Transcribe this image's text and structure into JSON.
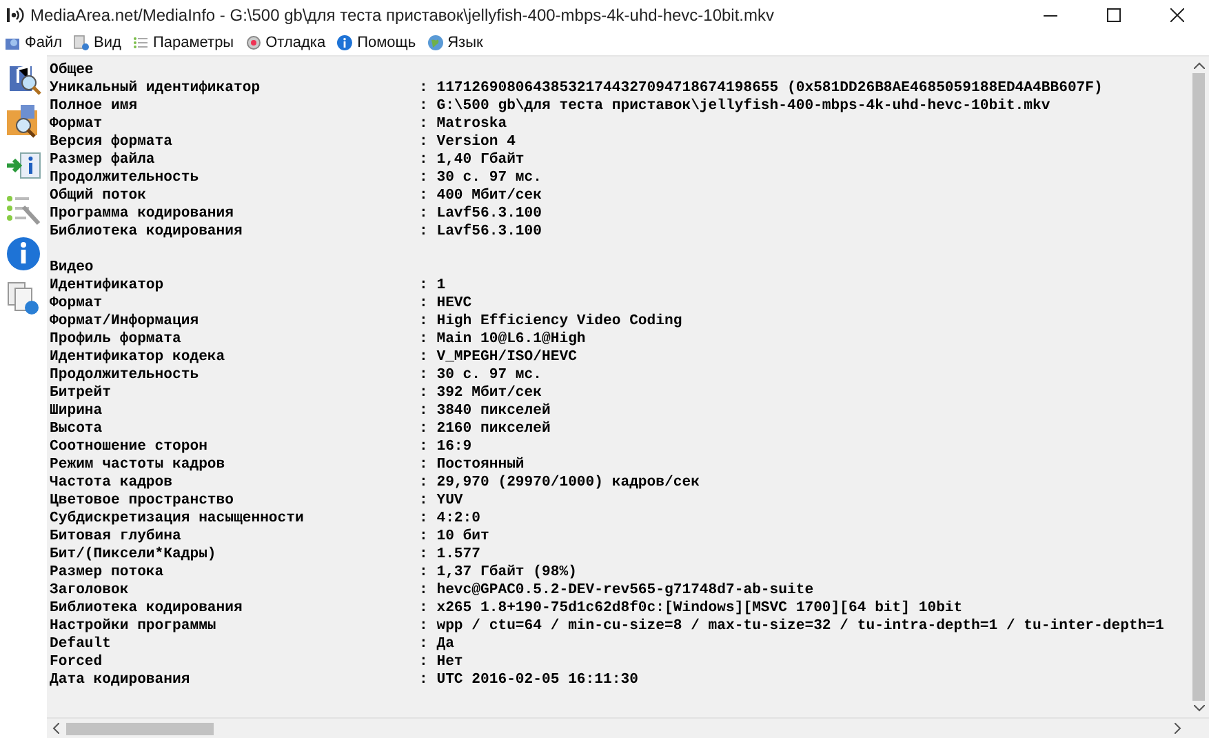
{
  "window": {
    "title": "MediaArea.net/MediaInfo - G:\\500 gb\\для теста приставок\\jellyfish-400-mbps-4k-uhd-hevc-10bit.mkv"
  },
  "menu": [
    {
      "label": "Файл"
    },
    {
      "label": "Вид"
    },
    {
      "label": "Параметры"
    },
    {
      "label": "Отладка"
    },
    {
      "label": "Помощь"
    },
    {
      "label": "Язык"
    }
  ],
  "sections": [
    {
      "title": "Общее",
      "rows": [
        {
          "key": "Уникальный идентификатор",
          "value": ": 117126908064385321744327094718674198655 (0x581DD26B8AE4685059188ED4A4BB607F)"
        },
        {
          "key": "Полное имя",
          "value": ": G:\\500 gb\\для теста приставок\\jellyfish-400-mbps-4k-uhd-hevc-10bit.mkv"
        },
        {
          "key": "Формат",
          "value": ": Matroska"
        },
        {
          "key": "Версия формата",
          "value": ": Version 4"
        },
        {
          "key": "Размер файла",
          "value": ": 1,40 Гбайт"
        },
        {
          "key": "Продолжительность",
          "value": ": 30 с. 97 мс."
        },
        {
          "key": "Общий поток",
          "value": ": 400 Мбит/сек"
        },
        {
          "key": "Программа кодирования",
          "value": ": Lavf56.3.100"
        },
        {
          "key": "Библиотека кодирования",
          "value": ": Lavf56.3.100"
        }
      ]
    },
    {
      "title": "Видео",
      "rows": [
        {
          "key": "Идентификатор",
          "value": ": 1"
        },
        {
          "key": "Формат",
          "value": ": HEVC"
        },
        {
          "key": "Формат/Информация",
          "value": ": High Efficiency Video Coding"
        },
        {
          "key": "Профиль формата",
          "value": ": Main 10@L6.1@High"
        },
        {
          "key": "Идентификатор кодека",
          "value": ": V_MPEGH/ISO/HEVC"
        },
        {
          "key": "Продолжительность",
          "value": ": 30 с. 97 мс."
        },
        {
          "key": "Битрейт",
          "value": ": 392 Мбит/сек"
        },
        {
          "key": "Ширина",
          "value": ": 3840 пикселей"
        },
        {
          "key": "Высота",
          "value": ": 2160 пикселей"
        },
        {
          "key": "Соотношение сторон",
          "value": ": 16:9"
        },
        {
          "key": "Режим частоты кадров",
          "value": ": Постоянный"
        },
        {
          "key": "Частота кадров",
          "value": ": 29,970 (29970/1000) кадров/сек"
        },
        {
          "key": "Цветовое пространство",
          "value": ": YUV"
        },
        {
          "key": "Субдискретизация насыщенности",
          "value": ": 4:2:0"
        },
        {
          "key": "Битовая глубина",
          "value": ": 10 бит"
        },
        {
          "key": "Бит/(Пиксели*Кадры)",
          "value": ": 1.577"
        },
        {
          "key": "Размер потока",
          "value": ": 1,37 Гбайт (98%)"
        },
        {
          "key": "Заголовок",
          "value": ": hevc@GPAC0.5.2-DEV-rev565-g71748d7-ab-suite"
        },
        {
          "key": "Библиотека кодирования",
          "value": ": x265 1.8+190-75d1c62d8f0c:[Windows][MSVC 1700][64 bit] 10bit"
        },
        {
          "key": "Настройки программы",
          "value": ": wpp / ctu=64 / min-cu-size=8 / max-tu-size=32 / tu-intra-depth=1 / tu-inter-depth=1"
        },
        {
          "key": "Default",
          "value": ": Да"
        },
        {
          "key": "Forced",
          "value": ": Нет"
        },
        {
          "key": "Дата кодирования",
          "value": ": UTC 2016-02-05 16:11:30"
        }
      ]
    }
  ]
}
